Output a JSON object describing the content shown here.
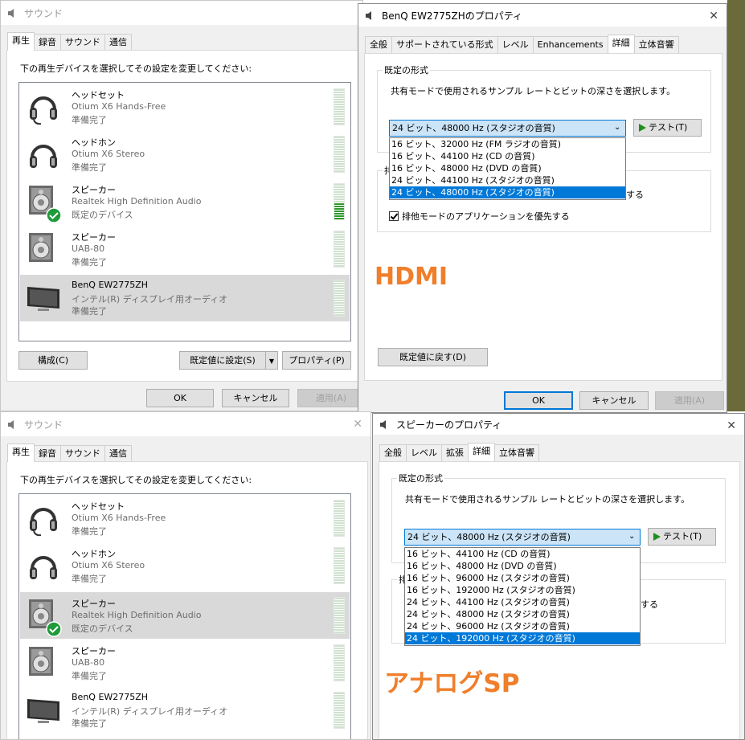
{
  "top": {
    "sound": {
      "title": "サウンド",
      "tabs": [
        "再生",
        "録音",
        "サウンド",
        "通信"
      ],
      "instruction": "下の再生デバイスを選択してその設定を変更してください:",
      "devices": [
        {
          "name": "ヘッドセット",
          "desc": "Otium X6 Hands-Free",
          "status": "準備完了",
          "icon": "headset-icon"
        },
        {
          "name": "ヘッドホン",
          "desc": "Otium X6 Stereo",
          "status": "準備完了",
          "icon": "headphones-icon"
        },
        {
          "name": "スピーカー",
          "desc": "Realtek High Definition Audio",
          "status": "既定のデバイス",
          "icon": "speaker-icon"
        },
        {
          "name": "スピーカー",
          "desc": "UAB-80",
          "status": "準備完了",
          "icon": "speaker-icon"
        },
        {
          "name": "BenQ EW2775ZH",
          "desc": "インテル(R) ディスプレイ用オーディオ",
          "status": "準備完了",
          "icon": "monitor-icon"
        }
      ],
      "buttons": {
        "configure": "構成(C)",
        "set_default": "既定値に設定(S)",
        "properties": "プロパティ(P)",
        "ok": "OK",
        "cancel": "キャンセル",
        "apply": "適用(A)"
      }
    },
    "props": {
      "title": "BenQ EW2775ZHのプロパティ",
      "tabs": [
        "全般",
        "サポートされている形式",
        "レベル",
        "Enhancements",
        "詳細",
        "立体音響"
      ],
      "group_title": "既定の形式",
      "group_desc": "共有モードで使用されるサンプル レートとビットの深さを選択します。",
      "selected": "24 ビット、48000 Hz (スタジオの音質)",
      "options": [
        "16 ビット、32000 Hz (FM ラジオの音質)",
        "16 ビット、44100 Hz (CD の音質)",
        "16 ビット、48000 Hz (DVD の音質)",
        "24 ビット、44100 Hz (スタジオの音質)",
        "24 ビット、48000 Hz (スタジオの音質)"
      ],
      "test": "テスト(T)",
      "excl_title": "排",
      "excl_tail": "する",
      "checkbox": "排他モードのアプリケーションを優先する",
      "restore": "既定値に戻す(D)",
      "ok": "OK",
      "cancel": "キャンセル",
      "apply": "適用(A)"
    },
    "annotation": "HDMI"
  },
  "bottom": {
    "sound": {
      "title": "サウンド",
      "tabs": [
        "再生",
        "録音",
        "サウンド",
        "通信"
      ],
      "instruction": "下の再生デバイスを選択してその設定を変更してください:",
      "devices": [
        {
          "name": "ヘッドセット",
          "desc": "Otium X6 Hands-Free",
          "status": "準備完了",
          "icon": "headset-icon"
        },
        {
          "name": "ヘッドホン",
          "desc": "Otium X6 Stereo",
          "status": "準備完了",
          "icon": "headphones-icon"
        },
        {
          "name": "スピーカー",
          "desc": "Realtek High Definition Audio",
          "status": "既定のデバイス",
          "icon": "speaker-icon"
        },
        {
          "name": "スピーカー",
          "desc": "UAB-80",
          "status": "準備完了",
          "icon": "speaker-icon"
        },
        {
          "name": "BenQ EW2775ZH",
          "desc": "インテル(R) ディスプレイ用オーディオ",
          "status": "準備完了",
          "icon": "monitor-icon"
        }
      ]
    },
    "props": {
      "title": "スピーカーのプロパティ",
      "tabs": [
        "全般",
        "レベル",
        "拡張",
        "詳細",
        "立体音響"
      ],
      "group_title": "既定の形式",
      "group_desc": "共有モードで使用されるサンプル レートとビットの深さを選択します。",
      "selected": "24 ビット、48000 Hz (スタジオの音質)",
      "options": [
        "16 ビット、44100 Hz (CD の音質)",
        "16 ビット、48000 Hz (DVD の音質)",
        "16 ビット、96000 Hz (スタジオの音質)",
        "16 ビット、192000 Hz (スタジオの音質)",
        "24 ビット、44100 Hz (スタジオの音質)",
        "24 ビット、48000 Hz (スタジオの音質)",
        "24 ビット、96000 Hz (スタジオの音質)",
        "24 ビット、192000 Hz (スタジオの音質)"
      ],
      "test": "テスト(T)",
      "excl_title": "排",
      "excl_tail": "する"
    },
    "annotation": "アナログSP"
  },
  "colors": {
    "accent": "#0078d7",
    "annotation": "#f07e2a",
    "check_green": "#1f9b3a",
    "meter_green": "#2e9a2e",
    "selected_row": "#d9d9d9"
  }
}
